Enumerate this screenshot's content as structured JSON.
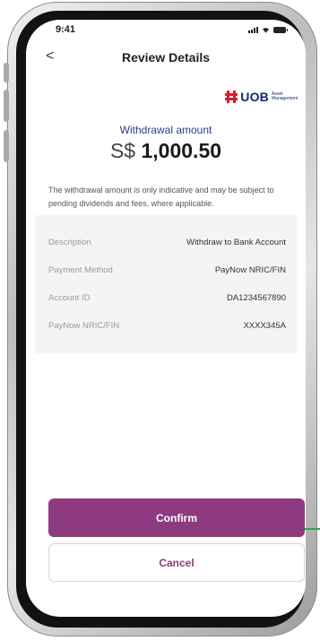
{
  "status": {
    "time": "9:41"
  },
  "nav": {
    "back": "<",
    "title": "Review Details"
  },
  "brand": {
    "name": "UOB",
    "subtitle": "Asset Management"
  },
  "amount": {
    "label": "Withdrawal amount",
    "currency": "S$",
    "value": "1,000.50"
  },
  "note": "The withdrawal amount is only indicative and may be subject to pending dividends and fees, where applicable.",
  "details": [
    {
      "label": "Description",
      "value": "Withdraw to Bank Account"
    },
    {
      "label": "Payment Method",
      "value": "PayNow NRIC/FIN"
    },
    {
      "label": "Account ID",
      "value": "DA1234567890"
    },
    {
      "label": "PayNow NRIC/FIN",
      "value": "XXXX345A"
    }
  ],
  "actions": {
    "confirm": "Confirm",
    "cancel": "Cancel"
  },
  "colors": {
    "primary": "#8e3a80",
    "accent_line": "#2eaa4f",
    "brand_red": "#d2202f",
    "brand_navy": "#0d2b6b"
  }
}
